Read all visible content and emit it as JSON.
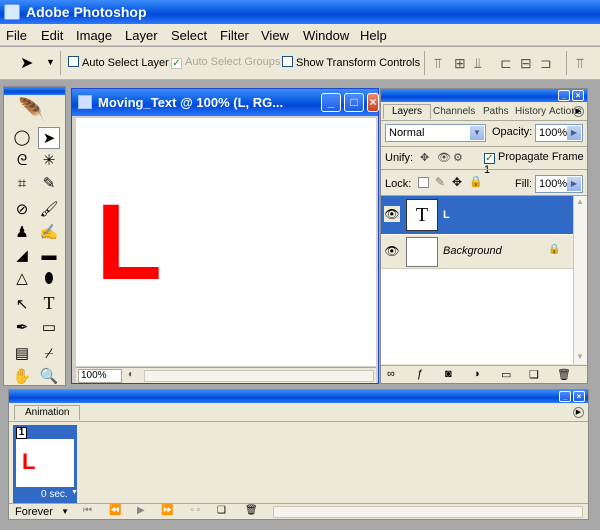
{
  "app": {
    "title": "Adobe Photoshop"
  },
  "menu": [
    "File",
    "Edit",
    "Image",
    "Layer",
    "Select",
    "Filter",
    "View",
    "Window",
    "Help"
  ],
  "options_bar": {
    "auto_select_layer": "Auto Select Layer",
    "auto_select_groups": "Auto Select Groups",
    "show_transform_controls": "Show Transform Controls"
  },
  "document": {
    "title": "Moving_Text @ 100% (L, RG...",
    "zoom": "100%",
    "canvas_text": "L",
    "text_color": "#ff0000"
  },
  "layers_panel": {
    "tabs": [
      "Layers",
      "Channels",
      "Paths",
      "History",
      "Actions"
    ],
    "blend_mode": "Normal",
    "opacity_label": "Opacity:",
    "opacity": "100%",
    "unify_label": "Unify:",
    "propagate_label": "Propagate Frame 1",
    "lock_label": "Lock:",
    "fill_label": "Fill:",
    "fill": "100%",
    "layers": [
      {
        "name": "L",
        "thumb": "T",
        "selected": true
      },
      {
        "name": "Background",
        "thumb": "",
        "selected": false
      }
    ]
  },
  "animation_panel": {
    "tab": "Animation",
    "frame_number": "1",
    "frame_delay": "0 sec.",
    "frame_content": "L",
    "loop": "Forever"
  }
}
